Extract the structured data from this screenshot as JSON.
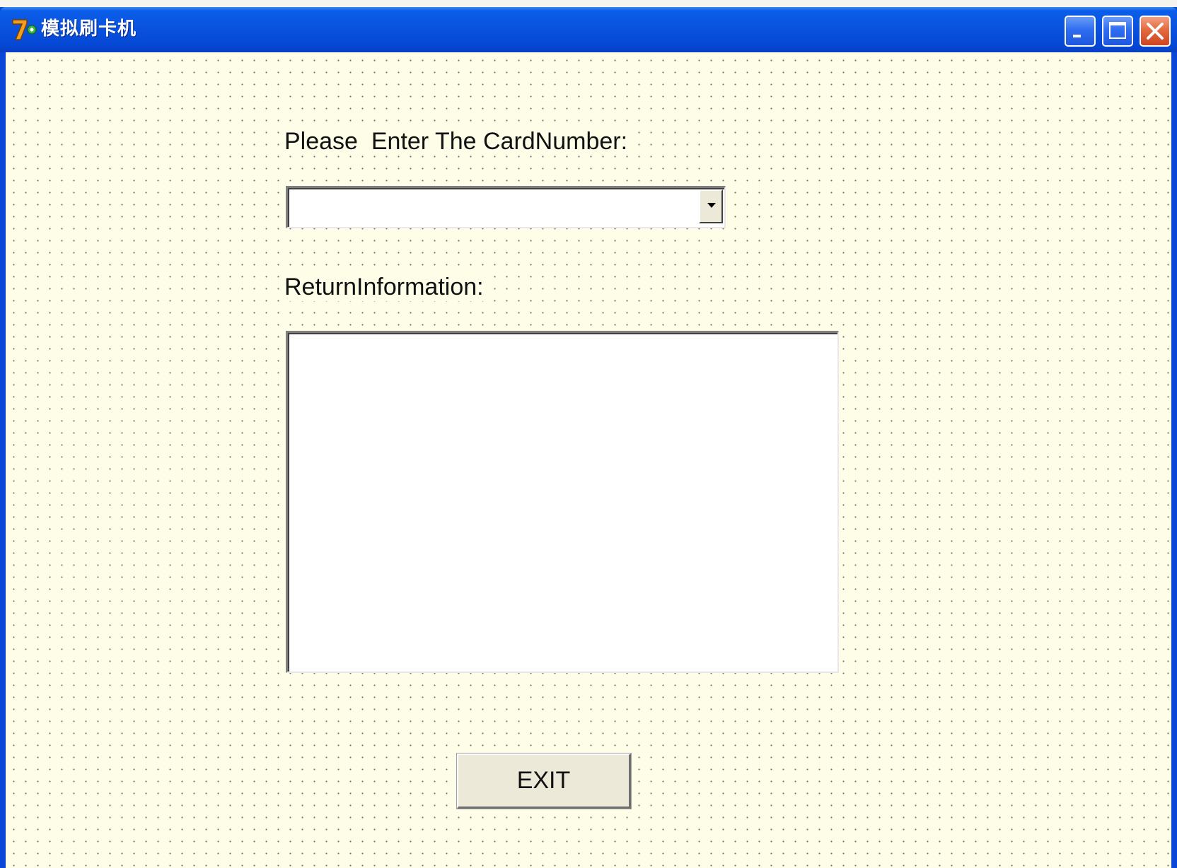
{
  "window": {
    "title": "模拟刷卡机",
    "icon": "app-7-icon",
    "controls": {
      "minimize": "minimize-icon",
      "maximize": "maximize-icon",
      "close": "close-icon"
    }
  },
  "form": {
    "card_label": "Please  Enter The CardNumber:",
    "card_value": "",
    "return_label": "ReturnInformation:",
    "return_value": "",
    "exit_label": "EXIT"
  },
  "colors": {
    "titlebar": "#0a54e0",
    "client_background": "#fdfde8",
    "grid_dots": "#6f6f6f",
    "button_face": "#ece9d8",
    "close_button": "#e46a3f"
  }
}
